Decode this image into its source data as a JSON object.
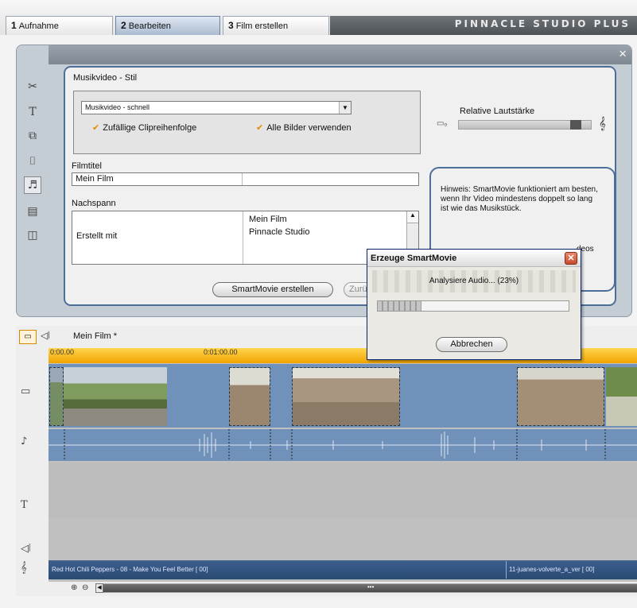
{
  "tabs": [
    {
      "number": "1",
      "label": "Aufnahme"
    },
    {
      "number": "2",
      "label": "Bearbeiten"
    },
    {
      "number": "3",
      "label": "Film erstellen"
    }
  ],
  "brand": "PINNACLE STUDIO PLUS",
  "panel": {
    "close_icon": "×",
    "section_title": "Musikvideo - Stil",
    "style_select_value": "Musikvideo - schnell",
    "checkbox_random_order": "Zufällige Clipreihenfolge",
    "checkbox_all_images": "Alle Bilder verwenden",
    "volume_label": "Relative Lautstärke",
    "volume_level": 0.92,
    "film_title_label": "Filmtitel",
    "film_title_value": "Mein Film",
    "credits_label": "Nachspann",
    "credits_left": "Erstellt mit",
    "credits_right_1": "Mein Film",
    "credits_right_2": "Pinnacle Studio",
    "hint_text": "Hinweis: SmartMovie funktioniert am besten, wenn Ihr Video mindestens doppelt so lang ist wie das Musikstück.",
    "hint_tail": "deos",
    "create_button": "SmartMovie erstellen",
    "reset_button": "Zurü"
  },
  "dialog": {
    "title": "Erzeuge SmartMovie",
    "status": "Analysiere Audio... (23%)",
    "progress": 0.23,
    "cancel_button": "Abbrechen"
  },
  "timeline": {
    "project_name": "Mein Film *",
    "ruler_start": "0:00.00",
    "ruler_mark": "0:01:00.00",
    "music_clip_1": "Red Hot Chili Peppers - 08 - Make You Feel Better [ 00]",
    "music_clip_2": "11-juanes-volverte_a_ver [ 00]"
  },
  "icons": {
    "storyboard": "storyboard-icon",
    "audio_view": "audio-view-icon",
    "video_track": "video-track-icon",
    "audio_track": "audio-track-icon",
    "title_track": "title-track-icon",
    "sound_effect": "sound-effect-icon",
    "music_track": "music-track-icon"
  },
  "colors": {
    "accent_blue": "#4e6e9a",
    "ruler_orange": "#f0a400",
    "track_blue": "#7091b9",
    "music_blue": "#294a73"
  }
}
